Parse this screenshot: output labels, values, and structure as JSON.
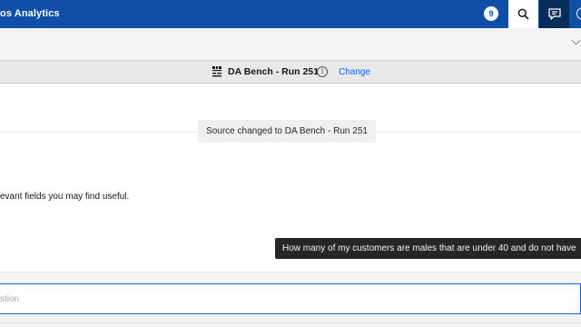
{
  "header": {
    "app_title": "os Analytics",
    "notification_count": "9",
    "icons": {
      "search": "search-icon",
      "chat": "chat-icon",
      "user": "user-icon"
    }
  },
  "source": {
    "name": "DA Bench - Run 251",
    "change_label": "Change",
    "icon": "dataset-icon"
  },
  "conversation": {
    "toast": "Source changed to DA Bench - Run 251",
    "hint": "evant fields you may find useful.",
    "tooltip": "How many of my customers are males that are under 40 and do not have"
  },
  "input": {
    "placeholder": "stion"
  },
  "colors": {
    "header_bg": "#0f4fa8",
    "accent": "#0f62fe",
    "tooltip_bg": "#262626"
  }
}
